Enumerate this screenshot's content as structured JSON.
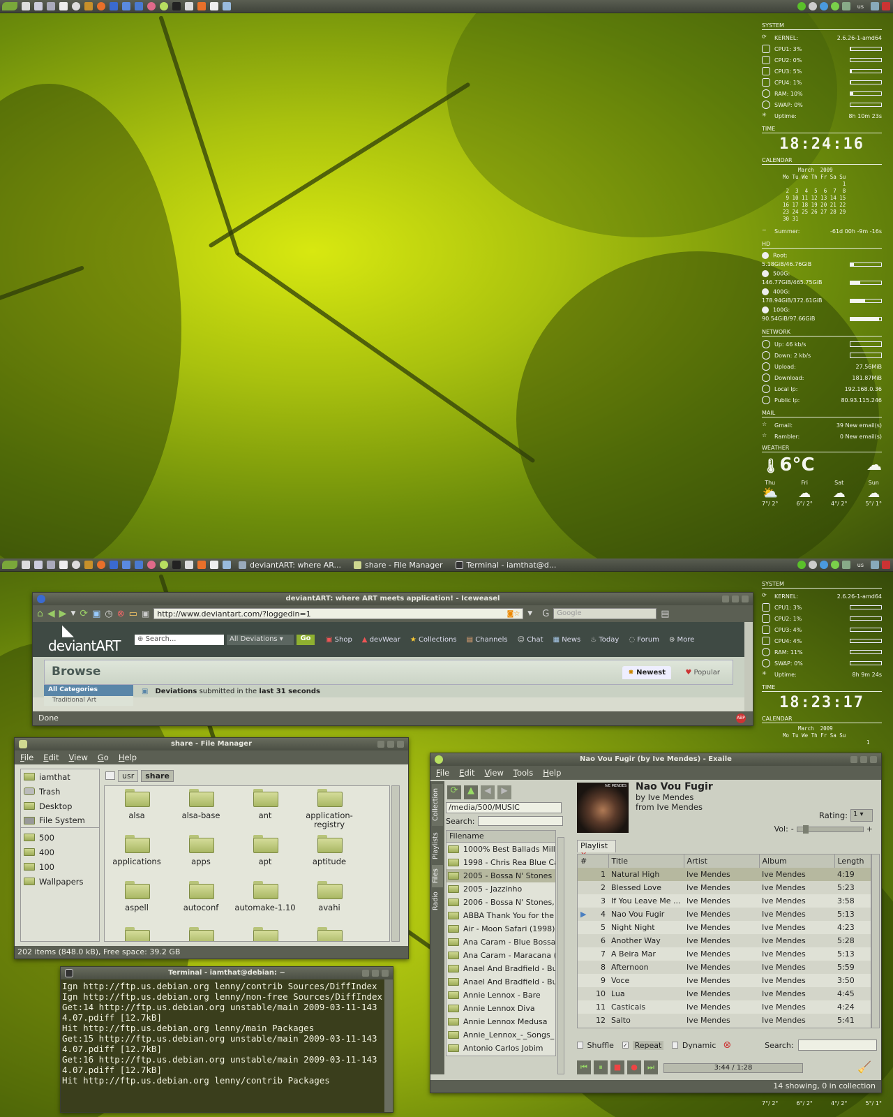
{
  "top_panel": {
    "taskbar_items": []
  },
  "bottom_panel": {
    "tasks": [
      {
        "label": "deviantART: where AR..."
      },
      {
        "label": "share - File Manager"
      },
      {
        "label": "Terminal - iamthat@d..."
      }
    ]
  },
  "tray": {
    "keyboard_layout": "us"
  },
  "conky_top": {
    "system_header": "SYSTEM",
    "kernel_label": "KERNEL:",
    "kernel_value": "2.6.26-1-amd64",
    "cpu1": "CPU1: 3%",
    "cpu1_level": 3,
    "cpu2": "CPU2: 0%",
    "cpu2_level": 0,
    "cpu3": "CPU3: 5%",
    "cpu3_level": 5,
    "cpu4": "CPU4: 1%",
    "cpu4_level": 1,
    "ram": "RAM: 10%",
    "ram_level": 10,
    "swap": "SWAP: 0%",
    "swap_level": 0,
    "uptime_label": "Uptime:",
    "uptime_value": "8h 10m 23s",
    "time_header": "TIME",
    "time": "18:24:16",
    "calendar_header": "CALENDAR",
    "calendar_title": "March  2009",
    "calendar_days": "Mo Tu We Th Fr Sa Su",
    "calendar_weeks": "                   1\n 2  3  4  5  6  7  8\n 9 10 11 12 13 14 15\n16 17 18 19 20 21 22\n23 24 25 26 27 28 29\n30 31",
    "summer_label": "Summer:",
    "summer_value": "-61d 00h -9m -16s",
    "hd_header": "HD",
    "root_label": "Root:",
    "root_value": "5.18GiB/46.76GiB",
    "root_level": 11,
    "d500_label": "500G:",
    "d500_value": "146.77GiB/465.75GiB",
    "d500_level": 31,
    "d400_label": "400G:",
    "d400_value": "178.94GiB/372.61GiB",
    "d400_level": 48,
    "d100_label": "100G:",
    "d100_value": "90.54GiB/97.66GiB",
    "d100_level": 93,
    "network_header": "NETWORK",
    "up_label": "Up: 46 kb/s",
    "down_label": "Down: 2 kb/s",
    "upload_label": "Upload:",
    "upload_value": "27.56MiB",
    "download_label": "Download:",
    "download_value": "181.87MiB",
    "localip_label": "Local Ip:",
    "localip_value": "192.168.0.36",
    "publicip_label": "Public Ip:",
    "publicip_value": "80.93.115.246",
    "mail_header": "MAIL",
    "gmail_label": "Gmail:",
    "gmail_value": "39 New email(s)",
    "rambler_label": "Rambler:",
    "rambler_value": "0 New email(s)",
    "weather_header": "WEATHER",
    "temperature": "6°C",
    "forecast": [
      {
        "day": "Thu",
        "temp": "7°/ 2°"
      },
      {
        "day": "Fri",
        "temp": "6°/ 2°"
      },
      {
        "day": "Sat",
        "temp": "4°/ 2°"
      },
      {
        "day": "Sun",
        "temp": "5°/ 1°"
      }
    ]
  },
  "conky_bottom": {
    "system_header": "SYSTEM",
    "kernel_label": "KERNEL:",
    "kernel_value": "2.6.26-1-amd64",
    "cpu1": "CPU1: 3%",
    "cpu2": "CPU2: 1%",
    "cpu3": "CPU3: 4%",
    "cpu4": "CPU4: 4%",
    "ram": "RAM: 11%",
    "swap": "SWAP: 0%",
    "uptime_label": "Uptime:",
    "uptime_value": "8h 9m 24s",
    "time_header": "TIME",
    "time": "18:23:17",
    "calendar_header": "CALENDAR",
    "calendar_title": "March  2009",
    "calendar_days": "Mo Tu We Th Fr Sa Su",
    "calendar_first": "1",
    "forecast_temps": [
      "7°/ 2°",
      "6°/ 2°",
      "4°/ 2°",
      "5°/ 1°"
    ]
  },
  "browser": {
    "title": "deviantART: where ART meets application! - Iceweasel",
    "url": "http://www.deviantart.com/?loggedin=1",
    "search_engine_placeholder": "Google",
    "logo_text": "deviantART",
    "search_placeholder": "Search...",
    "search_scope": "All Deviations",
    "go_label": "Go",
    "nav": [
      "Shop",
      "devWear",
      "Collections",
      "Channels",
      "Chat",
      "News",
      "Today",
      "Forum",
      "More"
    ],
    "browse_title": "Browse",
    "tab_newest": "Newest",
    "tab_popular": "Popular",
    "cat_all": "All Categories",
    "cat_traditional": "Traditional Art",
    "deviations_bold": "Deviations",
    "deviations_mid": " submitted in the ",
    "deviations_time": "last 31 seconds",
    "status": "Done"
  },
  "file_manager": {
    "title": "share - File Manager",
    "menu": [
      "File",
      "Edit",
      "View",
      "Go",
      "Help"
    ],
    "places": [
      "iamthat",
      "Trash",
      "Desktop",
      "File System"
    ],
    "bookmarks": [
      "500",
      "400",
      "100",
      "Wallpapers"
    ],
    "path": [
      "usr",
      "share"
    ],
    "folders": [
      "alsa",
      "alsa-base",
      "ant",
      "application-registry",
      "applications",
      "apps",
      "apt",
      "aptitude",
      "aspell",
      "autoconf",
      "automake-1.10",
      "avahi",
      "",
      "",
      "",
      ""
    ],
    "status": "202 items (848.0 kB), Free space: 39.2 GB"
  },
  "terminal": {
    "title": "Terminal - iamthat@debian: ~",
    "lines": [
      "Ign http://ftp.us.debian.org lenny/contrib Sources/DiffIndex",
      "Ign http://ftp.us.debian.org lenny/non-free Sources/DiffIndex",
      "Get:14 http://ftp.us.debian.org unstable/main 2009-03-11-1434.07.pdiff [12.7kB]",
      "Hit http://ftp.us.debian.org lenny/main Packages",
      "Get:15 http://ftp.us.debian.org unstable/main 2009-03-11-1434.07.pdiff [12.7kB]",
      "Get:16 http://ftp.us.debian.org unstable/main 2009-03-11-1434.07.pdiff [12.7kB]",
      "Hit http://ftp.us.debian.org lenny/contrib Packages"
    ]
  },
  "player": {
    "title": "Nao Vou Fugir (by Ive Mendes) - Exaile",
    "menu": [
      "File",
      "Edit",
      "View",
      "Tools",
      "Help"
    ],
    "side_tabs": [
      "Collection",
      "Playlists",
      "Files",
      "Radio"
    ],
    "path": "/media/500/MUSIC",
    "search_label": "Search:",
    "filename_header": "Filename",
    "files": [
      "1000% Best Ballads Mille",
      "1998 - Chris Rea Blue Ca",
      "2005 - Bossa N' Stones",
      "2005 - Jazzinho",
      "2006 - Bossa N' Stones, V",
      "ABBA Thank You for the m",
      "Air - Moon Safari (1998) F",
      "Ana Caram - Blue Bossa",
      "Ana Caram - Maracana (1",
      "Anael And Bradfield - Bu",
      "Anael And Bradfield - Bu",
      "Annie Lennox - Bare",
      "Annie Lennox Diva",
      "Annie Lennox Medusa",
      "Annie_Lennox_-_Songs_",
      "Antonio Carlos Jobim"
    ],
    "album_art_text": "IVE MENDES",
    "track_title": "Nao Vou Fugir",
    "track_by": "by Ive Mendes",
    "track_from": "from Ive Mendes",
    "rating_label": "Rating:",
    "rating_value": "1",
    "vol_label": "Vol:",
    "playlist_tab": "Playlist",
    "columns": [
      "#",
      "Title",
      "Artist",
      "Album",
      "Length"
    ],
    "tracks": [
      {
        "n": "1",
        "title": "Natural High",
        "artist": "Ive Mendes",
        "album": "Ive Mendes",
        "length": "4:19"
      },
      {
        "n": "2",
        "title": "Blessed Love",
        "artist": "Ive Mendes",
        "album": "Ive Mendes",
        "length": "5:23"
      },
      {
        "n": "3",
        "title": "If You Leave Me ...",
        "artist": "Ive Mendes",
        "album": "Ive Mendes",
        "length": "3:58"
      },
      {
        "n": "4",
        "title": "Nao Vou Fugir",
        "artist": "Ive Mendes",
        "album": "Ive Mendes",
        "length": "5:13"
      },
      {
        "n": "5",
        "title": "Night Night",
        "artist": "Ive Mendes",
        "album": "Ive Mendes",
        "length": "4:23"
      },
      {
        "n": "6",
        "title": "Another Way",
        "artist": "Ive Mendes",
        "album": "Ive Mendes",
        "length": "5:28"
      },
      {
        "n": "7",
        "title": "A Beira Mar",
        "artist": "Ive Mendes",
        "album": "Ive Mendes",
        "length": "5:13"
      },
      {
        "n": "8",
        "title": "Afternoon",
        "artist": "Ive Mendes",
        "album": "Ive Mendes",
        "length": "5:59"
      },
      {
        "n": "9",
        "title": "Voce",
        "artist": "Ive Mendes",
        "album": "Ive Mendes",
        "length": "3:50"
      },
      {
        "n": "10",
        "title": "Lua",
        "artist": "Ive Mendes",
        "album": "Ive Mendes",
        "length": "4:45"
      },
      {
        "n": "11",
        "title": "Casticais",
        "artist": "Ive Mendes",
        "album": "Ive Mendes",
        "length": "4:24"
      },
      {
        "n": "12",
        "title": "Salto",
        "artist": "Ive Mendes",
        "album": "Ive Mendes",
        "length": "5:41"
      }
    ],
    "shuffle_label": "Shuffle",
    "repeat_label": "Repeat",
    "dynamic_label": "Dynamic",
    "playlist_search_label": "Search:",
    "time": "3:44 / 1:28",
    "status": "14 showing, 0 in collection",
    "accent": "#4a7fc0"
  }
}
